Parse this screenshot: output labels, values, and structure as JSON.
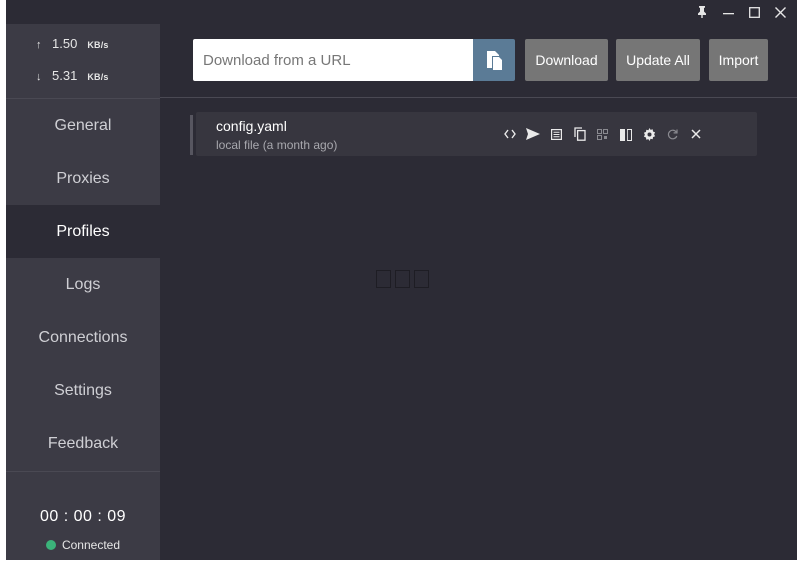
{
  "window": {
    "controls": [
      {
        "name": "pin-icon",
        "glyph": "🖈"
      },
      {
        "name": "minimize-icon",
        "glyph": "—"
      },
      {
        "name": "maximize-icon",
        "glyph": "☐"
      },
      {
        "name": "close-icon",
        "glyph": "✕"
      }
    ]
  },
  "traffic": {
    "up_arrow": "↑",
    "up_value": "1.50",
    "up_unit": "KB/s",
    "down_arrow": "↓",
    "down_value": "5.31",
    "down_unit": "KB/s"
  },
  "nav": {
    "items": [
      {
        "label": "General"
      },
      {
        "label": "Proxies"
      },
      {
        "label": "Profiles"
      },
      {
        "label": "Logs"
      },
      {
        "label": "Connections"
      },
      {
        "label": "Settings"
      },
      {
        "label": "Feedback"
      }
    ],
    "active": "Profiles"
  },
  "status": {
    "timer": "00 : 00 : 09",
    "connection": "Connected",
    "connection_color": "#3bb37a"
  },
  "toolbar": {
    "url_placeholder": "Download from a URL",
    "url_value": "",
    "paste_icon": "paste-icon",
    "download_label": "Download",
    "update_all_label": "Update All",
    "import_label": "Import",
    "accent_color": "#5b7b96"
  },
  "profiles": [
    {
      "name": "config.yaml",
      "subtitle": "local file (a month ago)",
      "actions": [
        "code-icon",
        "send-icon",
        "list-icon",
        "copy-icon",
        "qr-icon",
        "compare-icon",
        "gear-icon",
        "refresh-icon",
        "close-icon"
      ]
    }
  ],
  "placeholder_glyphs": "□□□"
}
